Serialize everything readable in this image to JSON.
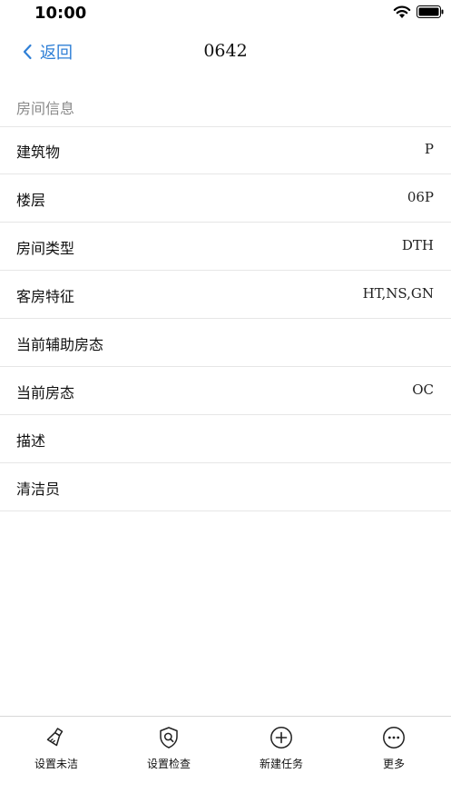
{
  "status_bar": {
    "time": "10:00"
  },
  "nav": {
    "back_label": "返回",
    "title": "0642"
  },
  "section": {
    "title": "房间信息"
  },
  "rows": [
    {
      "label": "建筑物",
      "value": "P"
    },
    {
      "label": "楼层",
      "value": "06P"
    },
    {
      "label": "房间类型",
      "value": "DTH"
    },
    {
      "label": "客房特征",
      "value": "HT,NS,GN"
    },
    {
      "label": "当前辅助房态",
      "value": ""
    },
    {
      "label": "当前房态",
      "value": "OC"
    },
    {
      "label": "描述",
      "value": ""
    },
    {
      "label": "清洁员",
      "value": ""
    }
  ],
  "toolbar": {
    "items": [
      {
        "label": "设置未洁",
        "icon": "broom-icon"
      },
      {
        "label": "设置检查",
        "icon": "shield-search-icon"
      },
      {
        "label": "新建任务",
        "icon": "plus-circle-icon"
      },
      {
        "label": "更多",
        "icon": "more-circle-icon"
      }
    ]
  },
  "colors": {
    "accent": "#2f7fd6",
    "divider": "#e6e6e6",
    "section_text": "#8a8a8a"
  }
}
